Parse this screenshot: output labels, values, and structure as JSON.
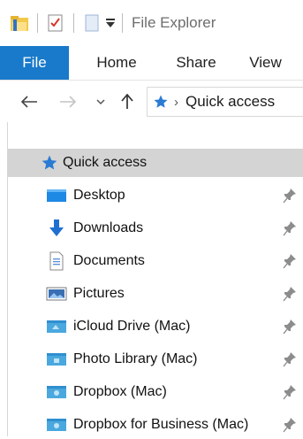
{
  "window": {
    "title": "File Explorer"
  },
  "ribbon": {
    "tabs": [
      {
        "label": "File",
        "active": true
      },
      {
        "label": "Home"
      },
      {
        "label": "Share"
      },
      {
        "label": "View"
      }
    ],
    "accent": "#1979ca"
  },
  "address": {
    "location": "Quick access"
  },
  "pane": {
    "quick_access": {
      "label": "Quick access",
      "selected": true
    },
    "items": [
      {
        "label": "Desktop",
        "icon": "desktop-icon",
        "pinned": true
      },
      {
        "label": "Downloads",
        "icon": "downloads-icon",
        "pinned": true
      },
      {
        "label": "Documents",
        "icon": "documents-icon",
        "pinned": true
      },
      {
        "label": "Pictures",
        "icon": "pictures-icon",
        "pinned": true
      },
      {
        "label": "iCloud Drive (Mac)",
        "icon": "folder-icon",
        "pinned": true
      },
      {
        "label": "Photo Library (Mac)",
        "icon": "folder-icon",
        "pinned": true
      },
      {
        "label": "Dropbox (Mac)",
        "icon": "folder-icon",
        "pinned": true
      },
      {
        "label": "Dropbox for Business (Mac)",
        "icon": "folder-icon",
        "pinned": true
      }
    ]
  }
}
